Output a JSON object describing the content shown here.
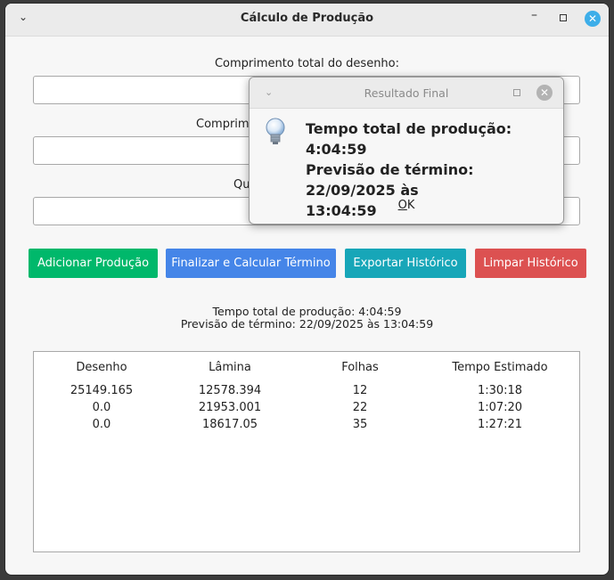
{
  "window": {
    "title": "Cálculo de Produção",
    "menu_icon": "chevron-down-icon",
    "minimize_icon": "minimize-icon",
    "maximize_icon": "maximize-icon",
    "close_icon": "close-icon",
    "close_color": "#3daee9"
  },
  "form": {
    "label1": "Comprimento total do desenho:",
    "label2_visible": "Comprim",
    "label3_visible": "Qu"
  },
  "buttons": {
    "add": {
      "label": "Adicionar Produção",
      "color": "#00b86b"
    },
    "finalize": {
      "label": "Finalizar e Calcular Término",
      "color": "#4585e8"
    },
    "export": {
      "label": "Exportar Histórico",
      "color": "#17a6b8"
    },
    "clear": {
      "label": "Limpar Histórico",
      "color": "#dc5151"
    }
  },
  "summary": {
    "total_time": "Tempo total de produção: 4:04:59",
    "forecast": "Previsão de término: 22/09/2025 às 13:04:59"
  },
  "table": {
    "headers": [
      "Desenho",
      "Lâmina",
      "Folhas",
      "Tempo Estimado"
    ],
    "rows": [
      [
        "25149.165",
        "12578.394",
        "12",
        "1:30:18"
      ],
      [
        "0.0",
        "21953.001",
        "22",
        "1:07:20"
      ],
      [
        "0.0",
        "18617.05",
        "35",
        "1:27:21"
      ]
    ]
  },
  "dialog": {
    "title": "Resultado Final",
    "icon": "lightbulb-icon",
    "line1": "Tempo total de produção: 4:04:59",
    "line2": "Previsão de término: 22/09/2025 às",
    "line3": "13:04:59",
    "ok_mnemonic": "O",
    "ok_rest": "K"
  }
}
